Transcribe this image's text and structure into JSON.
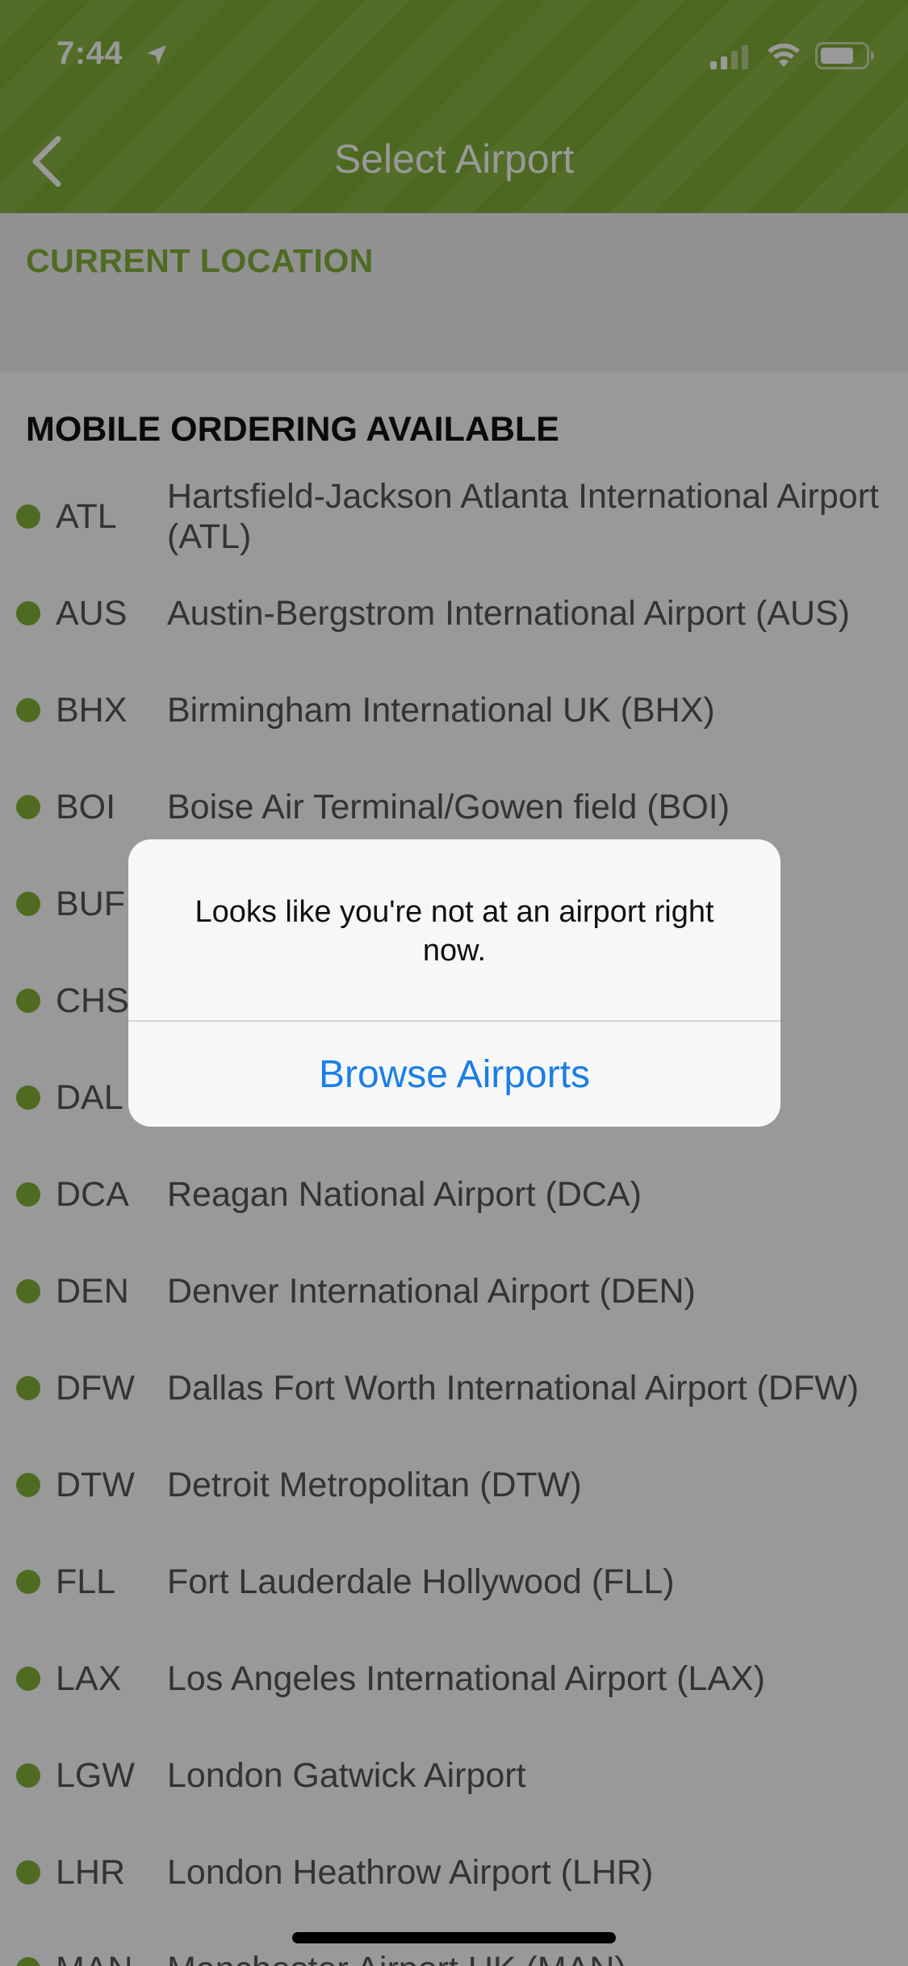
{
  "status_bar": {
    "time": "7:44",
    "icons": [
      "location-arrow-icon",
      "cellular-signal-icon",
      "wifi-icon",
      "battery-icon"
    ]
  },
  "nav": {
    "back_icon": "chevron-left-icon",
    "title": "Select Airport"
  },
  "current_location": {
    "title": "CURRENT LOCATION"
  },
  "mobile_ordering": {
    "title": "MOBILE ORDERING AVAILABLE",
    "airports": [
      {
        "code": "ATL",
        "name": "Hartsfield-Jackson Atlanta International Airport (ATL)"
      },
      {
        "code": "AUS",
        "name": "Austin-Bergstrom International Airport (AUS)"
      },
      {
        "code": "BHX",
        "name": "Birmingham International UK (BHX)"
      },
      {
        "code": "BOI",
        "name": "Boise Air Terminal/Gowen field (BOI)"
      },
      {
        "code": "BUF",
        "name": ""
      },
      {
        "code": "CHS",
        "name": ""
      },
      {
        "code": "DAL",
        "name": ""
      },
      {
        "code": "DCA",
        "name": "Reagan National Airport (DCA)"
      },
      {
        "code": "DEN",
        "name": "Denver International Airport (DEN)"
      },
      {
        "code": "DFW",
        "name": "Dallas Fort Worth International Airport (DFW)"
      },
      {
        "code": "DTW",
        "name": "Detroit Metropolitan  (DTW)"
      },
      {
        "code": "FLL",
        "name": "Fort Lauderdale Hollywood (FLL)"
      },
      {
        "code": "LAX",
        "name": "Los Angeles International Airport  (LAX)"
      },
      {
        "code": "LGW",
        "name": "London Gatwick Airport"
      },
      {
        "code": "LHR",
        "name": "London Heathrow Airport (LHR)"
      },
      {
        "code": "MAN",
        "name": "Manchester Airport UK (MAN)"
      }
    ]
  },
  "alert": {
    "message": "Looks like you're not at an airport right now.",
    "button_label": "Browse Airports"
  },
  "colors": {
    "brand_green": "#84b23a",
    "alert_button_blue": "#1a7ee6"
  }
}
